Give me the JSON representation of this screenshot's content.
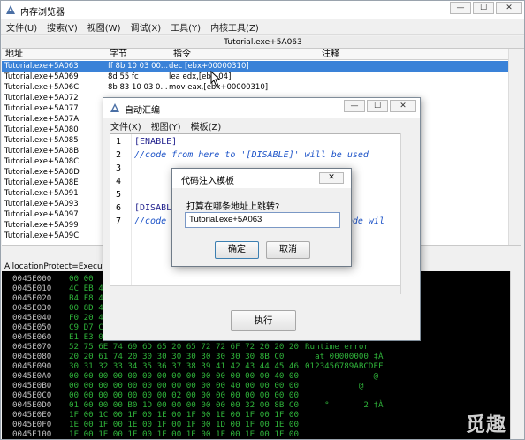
{
  "main": {
    "title": "内存浏览器",
    "window_buttons": [
      "—",
      "☐",
      "✕"
    ],
    "menu": [
      "文件(U)",
      "搜索(V)",
      "视图(W)",
      "调试(X)",
      "工具(Y)",
      "内核工具(Z)"
    ],
    "address_bar": "Tutorial.exe+5A063",
    "columns": [
      "地址",
      "字节",
      "指令",
      "注释"
    ],
    "rows": [
      {
        "addr": "Tutorial.exe+5A063",
        "bytes": "ff 8b 10 03 00...",
        "instr": "dec [ebx+00000310]"
      },
      {
        "addr": "Tutorial.exe+5A069",
        "bytes": "8d 55 fc",
        "instr": "lea edx,[ebp-04]"
      },
      {
        "addr": "Tutorial.exe+5A06C",
        "bytes": "8b 83 10 03 0...",
        "instr": "mov eax,[ebx+00000310]"
      },
      {
        "addr": "Tutorial.exe+5A072",
        "bytes": "",
        "instr": ""
      },
      {
        "addr": "Tutorial.exe+5A077",
        "bytes": "",
        "instr": ""
      },
      {
        "addr": "Tutorial.exe+5A07A",
        "bytes": "",
        "instr": ""
      },
      {
        "addr": "Tutorial.exe+5A080",
        "bytes": "",
        "instr": ""
      },
      {
        "addr": "Tutorial.exe+5A085",
        "bytes": "",
        "instr": ""
      },
      {
        "addr": "Tutorial.exe+5A08B",
        "bytes": "",
        "instr": ""
      },
      {
        "addr": "Tutorial.exe+5A08C",
        "bytes": "",
        "instr": ""
      },
      {
        "addr": "Tutorial.exe+5A08D",
        "bytes": "",
        "instr": ""
      },
      {
        "addr": "Tutorial.exe+5A08E",
        "bytes": "",
        "instr": ""
      },
      {
        "addr": "Tutorial.exe+5A091",
        "bytes": "",
        "instr": ""
      },
      {
        "addr": "Tutorial.exe+5A093",
        "bytes": "",
        "instr": ""
      },
      {
        "addr": "Tutorial.exe+5A097",
        "bytes": "",
        "instr": ""
      },
      {
        "addr": "Tutorial.exe+5A099",
        "bytes": "",
        "instr": ""
      },
      {
        "addr": "Tutorial.exe+5A09C",
        "bytes": "",
        "instr": ""
      }
    ],
    "info_line": "AllocationProtect=Execute/",
    "hex_rows": [
      {
        "addr": "0045E000",
        "bytes": "00 00",
        "ascii": ""
      },
      {
        "addr": "0045E010",
        "bytes": "4C EB 4",
        "ascii": ""
      },
      {
        "addr": "0045E020",
        "bytes": "B4 F8 4",
        "ascii": ""
      },
      {
        "addr": "0045E030",
        "bytes": "00 8D 4",
        "ascii": ""
      },
      {
        "addr": "0045E040",
        "bytes": "F0 20 4",
        "ascii": ""
      },
      {
        "addr": "0045E050",
        "bytes": "C9 D7 C",
        "ascii": ""
      },
      {
        "addr": "0045E060",
        "bytes": "E1 E3 0",
        "ascii": ""
      },
      {
        "addr": "0045E070",
        "bytes": "52 75 6E 74 69 6D 65 20 65 72 72 6F 72 20 20 20",
        "ascii": "Runtime error"
      },
      {
        "addr": "0045E080",
        "bytes": "20 20 61 74 20 30 30 30 30 30 30 30 30 8B C0",
        "ascii": "  at 00000000 ‡À"
      },
      {
        "addr": "0045E090",
        "bytes": "30 31 32 33 34 35 36 37 38 39 41 42 43 44 45 46",
        "ascii": "0123456789ABCDEF"
      },
      {
        "addr": "0045E0A0",
        "bytes": "00 00 00 00 00 00 00 00 00 00 00 00 00 00 40 00",
        "ascii": "              @"
      },
      {
        "addr": "0045E0B0",
        "bytes": "00 00 00 00 00 00 00 00 00 00 00 40 00 00 00 00",
        "ascii": "           @"
      },
      {
        "addr": "0045E0C0",
        "bytes": "00 00 00 00 00 00 00 02 00 00 00 00 00 00 00 00",
        "ascii": ""
      },
      {
        "addr": "0045E0D0",
        "bytes": "01 00 00 00 B0 1D 00 00 00 00 00 00 32 00 8B C0",
        "ascii": "    °       2 ‡À"
      },
      {
        "addr": "0045E0E0",
        "bytes": "1F 00 1C 00 1F 00 1E 00 1F 00 1E 00 1F 00 1F 00",
        "ascii": ""
      },
      {
        "addr": "0045E0F0",
        "bytes": "1E 00 1F 00 1E 00 1F 00 1F 00 1D 00 1F 00 1E 00",
        "ascii": ""
      },
      {
        "addr": "0045E100",
        "bytes": "1F 00 1E 00 1F 00 1F 00 1E 00 1F 00 1E 00 1F 00",
        "ascii": ""
      }
    ],
    "watermark": "觅趣网"
  },
  "auto_assemble": {
    "title": "自动汇编",
    "menu": [
      "文件(X)",
      "视图(Y)",
      "模板(Z)"
    ],
    "lines": [
      {
        "num": "1",
        "text": "[ENABLE]",
        "kind": "kw"
      },
      {
        "num": "2",
        "text": "//code from here to '[DISABLE]' will be used",
        "kind": "cm"
      },
      {
        "num": "3",
        "text": "",
        "kind": "kw"
      },
      {
        "num": "4",
        "text": "",
        "kind": "kw"
      },
      {
        "num": "5",
        "text": "",
        "kind": "kw"
      },
      {
        "num": "6",
        "text": "[DISABLE]",
        "kind": "kw"
      },
      {
        "num": "7",
        "text": "//code                                 code wil",
        "kind": "cm"
      }
    ],
    "execute_label": "执行"
  },
  "dialog": {
    "title": "代码注入模板",
    "prompt": "打算在哪条地址上跳转?",
    "input_value": "Tutorial.exe+5A063",
    "ok_label": "确定",
    "cancel_label": "取消"
  },
  "icons": {
    "app": "cheat-engine-icon",
    "cursor": "mouse-pointer-icon"
  },
  "colors": {
    "selection": "#3a82d8",
    "hex_text": "#2fb33a",
    "comment": "#1e54c8"
  }
}
